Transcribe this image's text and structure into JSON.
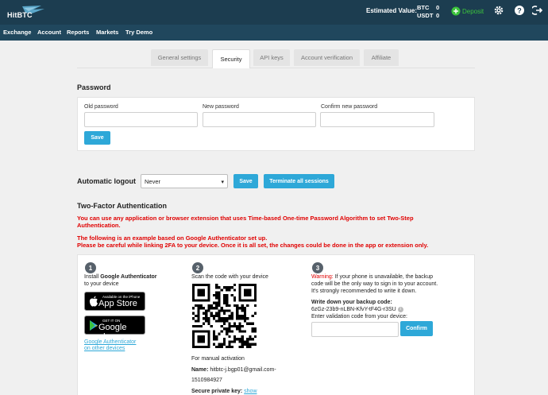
{
  "header": {
    "logo_text": "HitBTC",
    "estimated_label": "Estimated Value:",
    "balances": [
      {
        "currency": "BTC",
        "amount": "0"
      },
      {
        "currency": "USDT",
        "amount": "0"
      }
    ],
    "deposit_label": "Deposit"
  },
  "nav": [
    "Exchange",
    "Account",
    "Reports",
    "Markets",
    "Try Demo"
  ],
  "tabs": [
    "General settings",
    "Security",
    "API keys",
    "Account verification",
    "Affiliate"
  ],
  "password": {
    "title": "Password",
    "old_label": "Old password",
    "new_label": "New password",
    "confirm_label": "Confirm new password",
    "save_label": "Save"
  },
  "logout": {
    "label": "Automatic logout",
    "selected": "Never",
    "save_label": "Save",
    "terminate_label": "Terminate all sessions"
  },
  "twofa": {
    "title": "Two-Factor Authentication",
    "notice1_line1": "You can use any application or browser extension that uses Time-based One-time Password Algorithm to set Two-Step",
    "notice1_line2": "Authentication.",
    "notice2_line1": "The following is an example based on Google Authenticator set up.",
    "notice2_line2": "Please be careful while linking 2FA to your device. Once it is all set, the changes could be done in the app or extension only.",
    "step1": {
      "num": "1",
      "line1_pre": "Install ",
      "line1_bold": "Google Authenticator",
      "line2": "to your device",
      "appstore_small": "Available on the iPhone",
      "appstore_big": "App Store",
      "googleplay_small": "GET IT ON",
      "googleplay_big": "Google play",
      "link_line1": "Google Authenticator",
      "link_line2": "on other devices"
    },
    "step2": {
      "num": "2",
      "scan_text": "Scan the code with your device",
      "manual_text": "For manual activation",
      "name_label": "Name:",
      "name_value_line1": "hitbtc-j.bgp01@gmail.com-",
      "name_value_line2": "1510984927",
      "key_label": "Secure private key:",
      "key_link": "show"
    },
    "step3": {
      "num": "3",
      "warning_word": "Warning:",
      "warning_rest1": " If your phone is unavailable, the backup",
      "warning_line2": "code will be the only way to sign in to your account.",
      "warning_line3": "It's strongly recommended to write it down.",
      "backup_title": "Write down your backup code:",
      "backup_code": "6zGz-23b9-nLBN-KfvY-tF4G-r3SU",
      "validation_label": "Enter validation code from your device:",
      "confirm_label": "Confirm"
    }
  },
  "colors": {
    "topbar": "#1c3d50",
    "navbar": "#20475d",
    "accent": "#2ea8d8",
    "warning": "#e00000",
    "deposit": "#3cc33c"
  }
}
